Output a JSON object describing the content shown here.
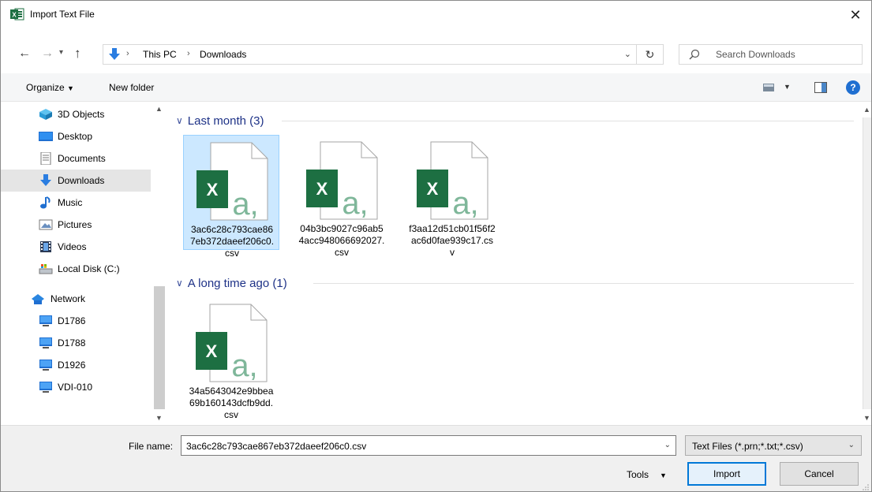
{
  "window": {
    "title": "Import Text File",
    "close_icon": "close-icon"
  },
  "address": {
    "breadcrumbs": [
      "This PC",
      "Downloads"
    ],
    "search_placeholder": "Search Downloads"
  },
  "commandbar": {
    "organize_label": "Organize",
    "new_folder_label": "New folder"
  },
  "navigation": {
    "items": [
      {
        "label": "3D Objects",
        "icon": "3d-objects-icon"
      },
      {
        "label": "Desktop",
        "icon": "desktop-icon"
      },
      {
        "label": "Documents",
        "icon": "documents-icon"
      },
      {
        "label": "Downloads",
        "icon": "downloads-icon",
        "selected": true
      },
      {
        "label": "Music",
        "icon": "music-icon"
      },
      {
        "label": "Pictures",
        "icon": "pictures-icon"
      },
      {
        "label": "Videos",
        "icon": "videos-icon"
      },
      {
        "label": "Local Disk (C:)",
        "icon": "local-disk-icon"
      },
      {
        "label": "Network",
        "icon": "network-icon"
      },
      {
        "label": "D1786",
        "icon": "computer-icon"
      },
      {
        "label": "D1788",
        "icon": "computer-icon"
      },
      {
        "label": "D1926",
        "icon": "computer-icon"
      },
      {
        "label": "VDI-010",
        "icon": "computer-icon"
      }
    ]
  },
  "groups": [
    {
      "header": "Last month (3)",
      "files": [
        {
          "name": "3ac6c28c793cae867eb372daeef206c0.csv",
          "selected": true
        },
        {
          "name": "04b3bc9027c96ab54acc948066692027.csv",
          "selected": false
        },
        {
          "name": "f3aa12d51cb01f56f2ac6d0fae939c17.csv",
          "selected": false
        }
      ]
    },
    {
      "header": "A long time ago (1)",
      "files": [
        {
          "name": "34a5643042e9bbea69b160143dcfb9dd.csv",
          "selected": false
        }
      ]
    }
  ],
  "footer": {
    "file_name_label": "File name:",
    "file_name_value": "3ac6c28c793cae867eb372daeef206c0.csv",
    "file_type_value": "Text Files (*.prn;*.txt;*.csv)",
    "tools_label": "Tools",
    "import_label": "Import",
    "cancel_label": "Cancel"
  },
  "colors": {
    "excel_green": "#1d6f42",
    "selection_bg": "#cce8ff",
    "group_header": "#1e3287",
    "accent": "#0078d7"
  }
}
